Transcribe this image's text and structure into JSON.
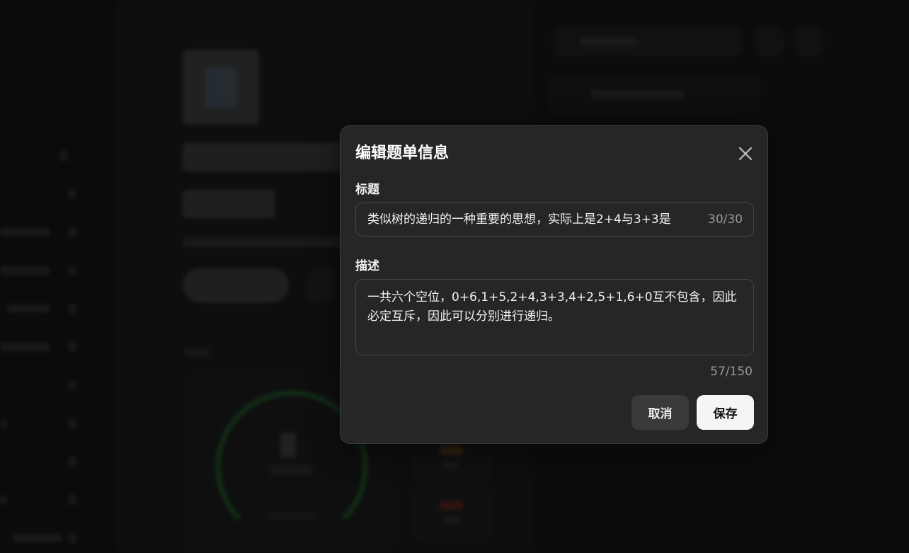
{
  "dialog": {
    "title": "编辑题单信息",
    "title_field": {
      "label": "标题",
      "value": "类似树的递归的一种重要的思想，实际上是2+4与3+3是",
      "counter": "30/30"
    },
    "description_field": {
      "label": "描述",
      "value": "一共六个空位，0+6,1+5,2+4,3+3,4+2,5+1,6+0互不包含，因此必定互斥，因此可以分别进行递归。",
      "counter": "57/150"
    },
    "buttons": {
      "cancel": "取消",
      "save": "保存"
    },
    "icons": {
      "close": "close-icon"
    }
  },
  "colors": {
    "modal_bg": "#262626",
    "save_bg": "#f5f5f5",
    "cancel_bg": "#3a3a3a",
    "ring_accent": "#1f5a2a"
  }
}
